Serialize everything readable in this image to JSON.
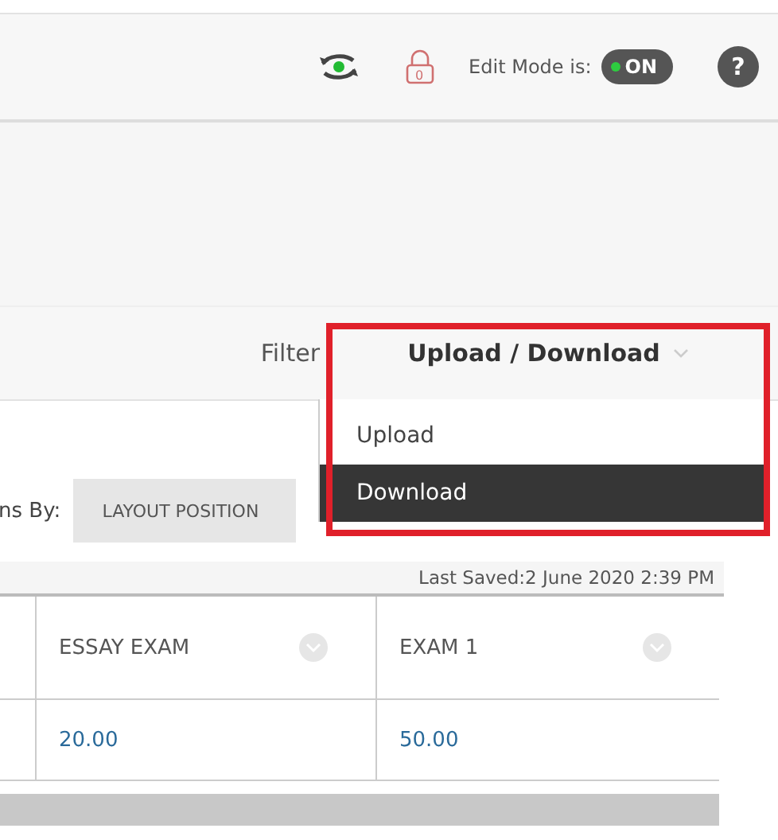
{
  "toolbar": {
    "lock_count": "0",
    "help": "?",
    "edit_mode": {
      "label": "Edit Mode is:",
      "value": "ON",
      "on": true
    }
  },
  "filter": {
    "label": "Filter",
    "value": "Upload / Download",
    "expanded": true,
    "options": [
      {
        "label": "Upload",
        "selected": false
      },
      {
        "label": "Download",
        "selected": true
      }
    ]
  },
  "sort": {
    "label": "ns By:",
    "button": "LAYOUT POSITION"
  },
  "last_saved": "Last Saved:2 June 2020 2:39 PM",
  "table": {
    "columns": [
      "ESSAY EXAM",
      "EXAM 1"
    ],
    "rows": [
      [
        "20.00",
        "50.00"
      ]
    ]
  },
  "highlight": true
}
